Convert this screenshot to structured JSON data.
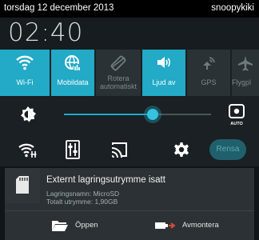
{
  "status_bar": {
    "date": "torsdag 12 december 2013",
    "carrier": "snoopykiki"
  },
  "clock": {
    "time": "02:40"
  },
  "quick_settings": {
    "tiles": [
      {
        "label": "Wi-Fi",
        "state": "on",
        "icon": "wifi-icon"
      },
      {
        "label": "Mobildata",
        "state": "on",
        "icon": "mobile-data-icon"
      },
      {
        "label": "Rotera automatiskt",
        "state": "off",
        "icon": "rotate-icon"
      },
      {
        "label": "Ljud av",
        "state": "on",
        "icon": "sound-off-icon"
      },
      {
        "label": "GPS",
        "state": "off",
        "icon": "gps-icon"
      },
      {
        "label": "Flygpl",
        "state": "off",
        "icon": "airplane-icon"
      }
    ],
    "brightness": {
      "level_percent": 59,
      "auto_label": "AUTO"
    },
    "actions": {
      "clear_label": "Rensa"
    }
  },
  "notification": {
    "title": "Externt lagringsutrymme isatt",
    "line1": "Lagringsnamn: MicroSD",
    "line2": "Totalt utrymme: 1,90GB",
    "open_label": "Öppen",
    "unmount_label": "Avmontera"
  },
  "colors": {
    "accent": "#22aac6",
    "background": "#0f1518"
  }
}
